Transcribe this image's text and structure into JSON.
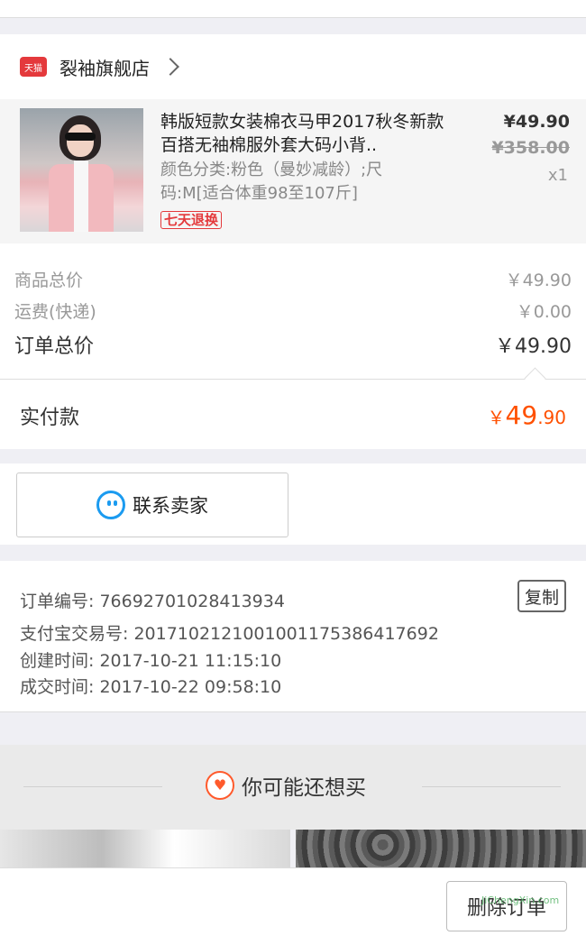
{
  "store": {
    "badge": "天猫",
    "name": "裂袖旗舰店"
  },
  "product": {
    "title": "韩版短款女装棉衣马甲2017秋冬新款百搭无袖棉服外套大码小背..",
    "spec": "颜色分类:粉色（曼妙减龄）;尺码:M[适合体重98至107斤]",
    "return_tag": "七天退换",
    "price_now": "¥49.90",
    "price_old": "¥358.00",
    "quantity": "x1"
  },
  "summary": {
    "goods_label": "商品总价",
    "goods_value": "￥49.90",
    "shipping_label": "运费(快递)",
    "shipping_value": "￥0.00",
    "total_label": "订单总价",
    "total_value": "￥49.90"
  },
  "paid": {
    "label": "实付款",
    "currency": "￥",
    "integer": "49",
    "decimal": ".90"
  },
  "contact": {
    "label": "联系卖家"
  },
  "order_info": {
    "order_no": "订单编号: 76692701028413934",
    "alipay_no": "支付宝交易号: 2017102121001001175386417692",
    "created": "创建时间: 2017-10-21 11:15:10",
    "completed": "成交时间: 2017-10-22 09:58:10",
    "copy_label": "复制"
  },
  "recommend": {
    "title": "你可能还想买",
    "icon": "heart-icon"
  },
  "actions": {
    "delete_label": "删除订单"
  },
  "watermark": "JiChengXin.com",
  "colors": {
    "accent": "#ff5000",
    "tmall_red": "#e4393c",
    "chat_blue": "#1b9bf0"
  }
}
